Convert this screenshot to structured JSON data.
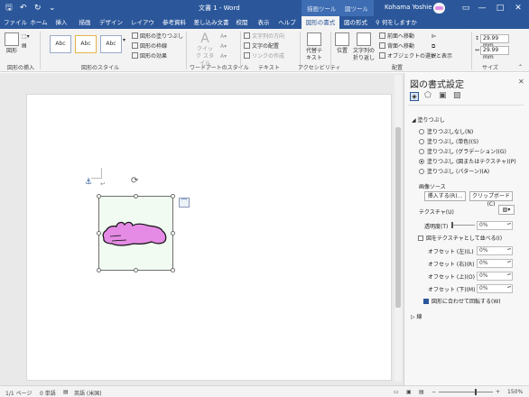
{
  "titlebar": {
    "title": "文書 1  -  Word",
    "context_drawing": "描画ツール",
    "context_picture": "図ツール",
    "user": "Kohama Yoshie",
    "minimize": "—",
    "restore": "□",
    "close": "✕"
  },
  "tabs": [
    "ファイル",
    "ホーム",
    "挿入",
    "描画",
    "デザイン",
    "レイアウト",
    "参考資料",
    "差し込み文書",
    "校閲",
    "表示",
    "ヘルプ",
    "図形の書式",
    "図の形式"
  ],
  "tell_me": "何をしますか",
  "ribbon": {
    "insert_shape": {
      "label": "図形の挿入",
      "btn": "図形"
    },
    "shape_styles": {
      "label": "図形のスタイル",
      "previews": [
        "Abc",
        "Abc",
        "Abc"
      ],
      "fill": "図形の塗りつぶし",
      "outline": "図形の枠線",
      "effects": "図形の効果"
    },
    "wordart": {
      "label": "ワードアートのスタイル",
      "quick": "クイック スタイル"
    },
    "text": {
      "label": "テキスト",
      "direction": "文字列の方向",
      "align": "文字の配置",
      "link": "リンクの作成"
    },
    "accessibility": {
      "label": "アクセシビリティ",
      "alt": "代替テキスト"
    },
    "arrange": {
      "label": "配置",
      "position": "位置",
      "wrap": "文字列の折り返し",
      "forward": "前面へ移動",
      "backward": "背面へ移動",
      "selection": "オブジェクトの選択と表示"
    },
    "size": {
      "label": "サイズ",
      "height": "29.99 mm",
      "width": "29.99 mm"
    }
  },
  "pane": {
    "title": "図の書式設定",
    "section": "塗りつぶし",
    "options": [
      {
        "label": "塗りつぶしなし(N)",
        "checked": false
      },
      {
        "label": "塗りつぶし (単色)(S)",
        "checked": false
      },
      {
        "label": "塗りつぶし (グラデーション)(G)",
        "checked": false
      },
      {
        "label": "塗りつぶし (図またはテクスチャ)(P)",
        "checked": true
      },
      {
        "label": "塗りつぶし (パターン)(A)",
        "checked": false
      }
    ],
    "image_source": "画像ソース",
    "insert_btn": "挿入する(R)...",
    "clipboard_btn": "クリップボード(C)",
    "texture": "テクスチャ(U)",
    "transparency": "透明度(T)",
    "transparency_value": "0%",
    "tile": "図をテクスチャとして並べる(I)",
    "offsets": [
      {
        "label": "オフセット (左)(L)",
        "value": "0%"
      },
      {
        "label": "オフセット (右)(R)",
        "value": "0%"
      },
      {
        "label": "オフセット (上)(O)",
        "value": "0%"
      },
      {
        "label": "オフセット (下)(M)",
        "value": "0%"
      }
    ],
    "rotate": "図形に合わせて回転する(W)",
    "line": "線"
  },
  "status": {
    "page": "1/1 ページ",
    "words": "0 単語",
    "lang": "英語 (米国)",
    "zoom": "150%"
  },
  "colors": {
    "accent": "#2b579a",
    "shape_fill": "#f1fbf1",
    "blob": "#e58be5"
  }
}
